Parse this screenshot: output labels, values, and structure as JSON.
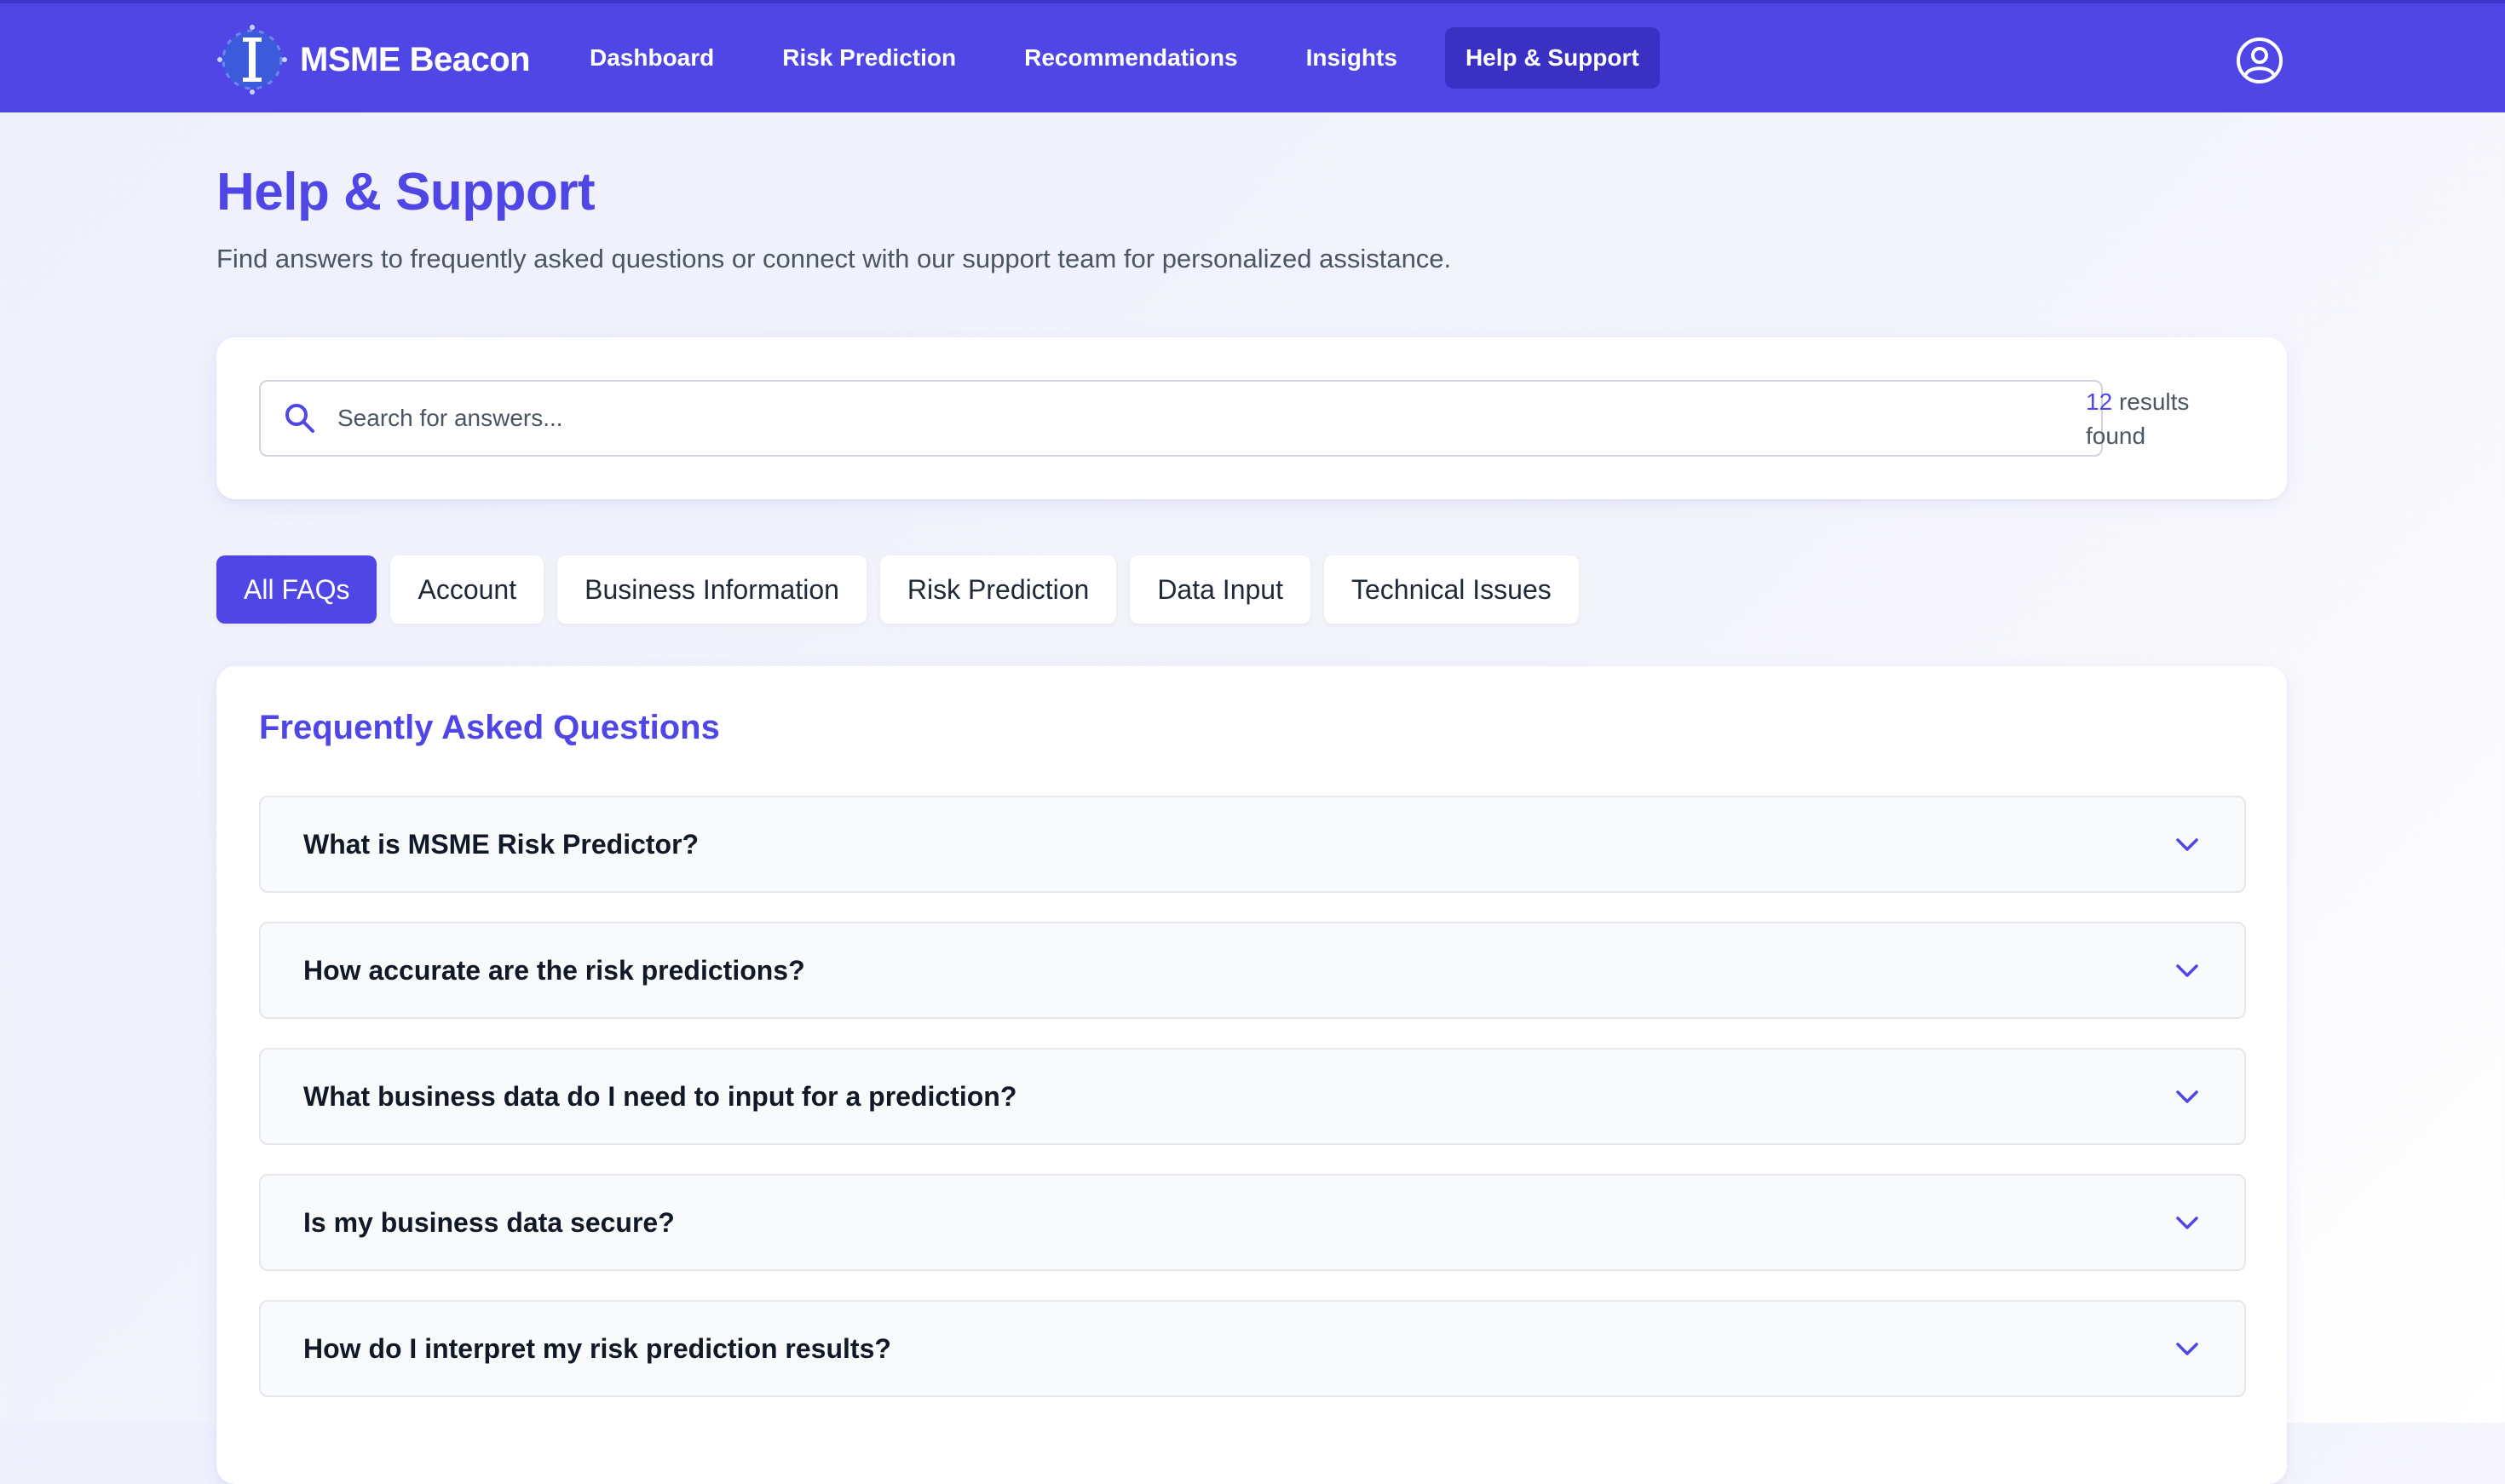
{
  "header": {
    "brand_name": "MSME Beacon",
    "nav": [
      {
        "label": "Dashboard",
        "active": false
      },
      {
        "label": "Risk Prediction",
        "active": false
      },
      {
        "label": "Recommendations",
        "active": false
      },
      {
        "label": "Insights",
        "active": false
      },
      {
        "label": "Help & Support",
        "active": true
      }
    ],
    "user_icon": "user-circle-icon"
  },
  "page": {
    "title": "Help & Support",
    "subtitle": "Find answers to frequently asked questions or connect with our support team for personalized assistance."
  },
  "search": {
    "placeholder": "Search for answers...",
    "value": "",
    "results_count": "12",
    "results_suffix": "results found",
    "icon": "search-icon"
  },
  "categories": [
    {
      "label": "All FAQs",
      "active": true
    },
    {
      "label": "Account",
      "active": false
    },
    {
      "label": "Business Information",
      "active": false
    },
    {
      "label": "Risk Prediction",
      "active": false
    },
    {
      "label": "Data Input",
      "active": false
    },
    {
      "label": "Technical Issues",
      "active": false
    }
  ],
  "faq": {
    "heading": "Frequently Asked Questions",
    "items": [
      {
        "question": "What is MSME Risk Predictor?"
      },
      {
        "question": "How accurate are the risk predictions?"
      },
      {
        "question": "What business data do I need to input for a prediction?"
      },
      {
        "question": "Is my business data secure?"
      },
      {
        "question": "How do I interpret my risk prediction results?"
      }
    ],
    "expand_icon": "chevron-down-icon"
  },
  "colors": {
    "primary": "#4f46e5",
    "nav_active": "#3a31c4",
    "background": "#eef0fd"
  }
}
